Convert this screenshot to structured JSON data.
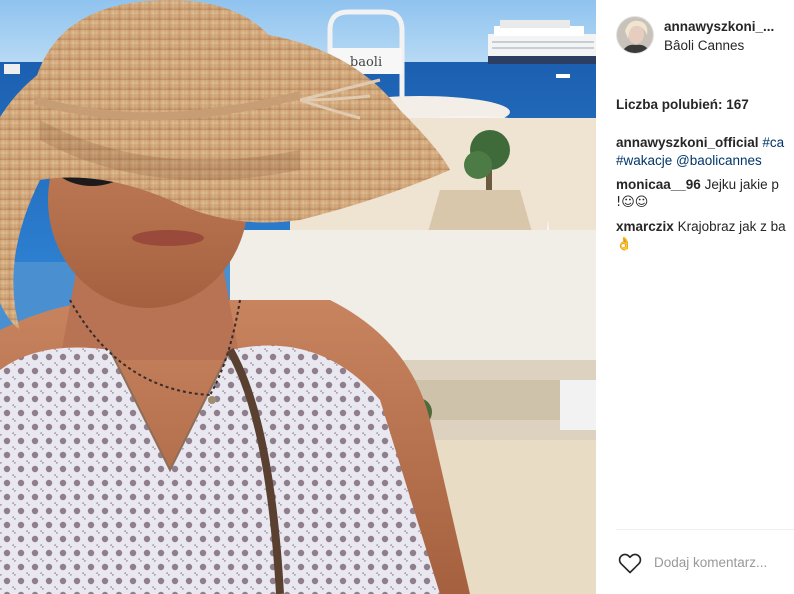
{
  "post": {
    "username": "annawyszkoni_...",
    "location": "Bâoli Cannes",
    "likes_label": "Liczba polubień: 167",
    "photo_sign_text": "baoli"
  },
  "comments": [
    {
      "author": "annawyszkoni_official",
      "text_tag": "#ca",
      "line2_tag1": "#wakacje",
      "line2_tag2": "@baolicannes"
    },
    {
      "author": "monicaa__96",
      "text": "Jejku jakie p",
      "line2": "!☺☺"
    },
    {
      "author": "xmarczix",
      "text": "Krajobraz jak z ba",
      "line2": "👌"
    }
  ],
  "footer": {
    "comment_placeholder": "Dodaj komentarz..."
  },
  "icons": {
    "like": "heart-outline-icon"
  },
  "colors": {
    "text": "#262626",
    "link": "#003569",
    "placeholder": "#999999",
    "divider": "#efefef"
  }
}
